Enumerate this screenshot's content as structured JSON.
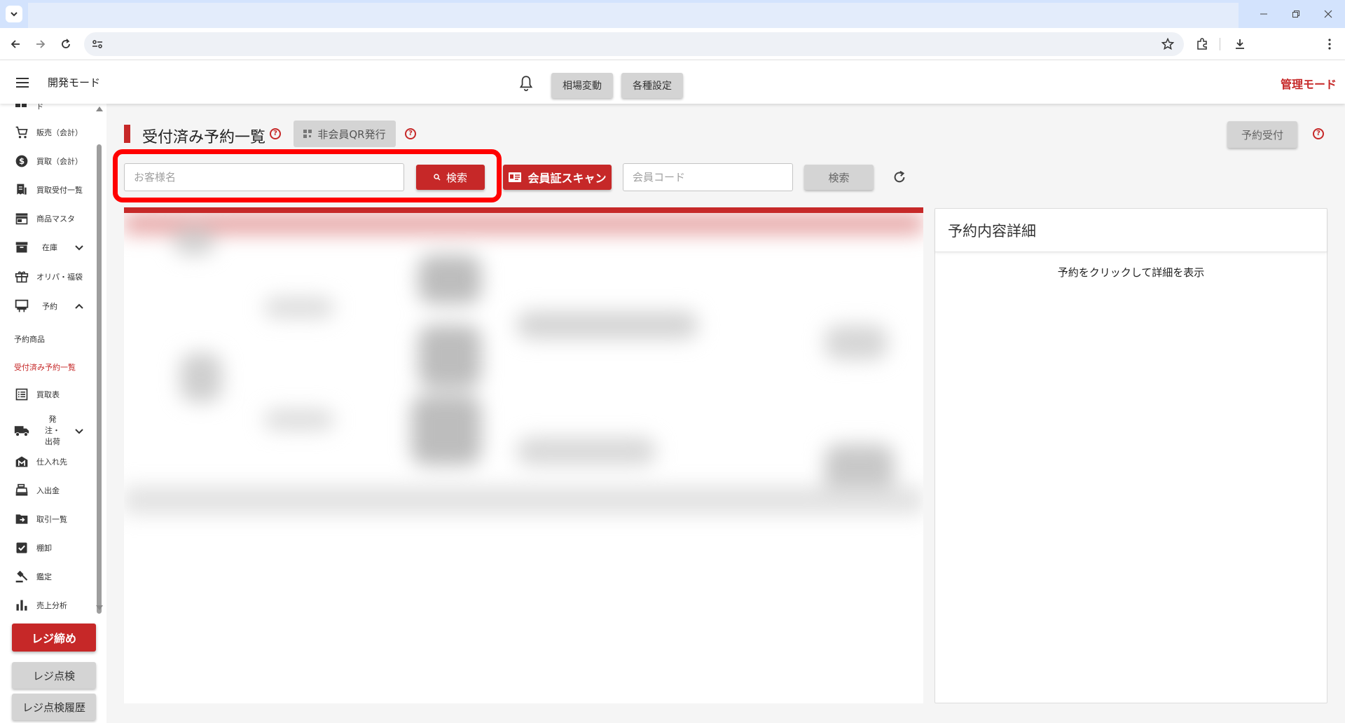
{
  "header": {
    "mode_title": "開発モード",
    "btn_market": "相場変動",
    "btn_settings": "各種設定",
    "admin_mode": "管理モード"
  },
  "sidebar": {
    "partial_item": "ド",
    "items": [
      {
        "label": "販売（会計）",
        "icon": "cart-icon"
      },
      {
        "label": "買取（会計）",
        "icon": "dollar-icon"
      },
      {
        "label": "買取受付一覧",
        "icon": "receipt-icon"
      },
      {
        "label": "商品マスタ",
        "icon": "store-icon"
      },
      {
        "label": "在庫",
        "icon": "archive-icon"
      },
      {
        "label": "オリパ・福袋",
        "icon": "gift-icon"
      },
      {
        "label": "予約",
        "icon": "kiosk-icon"
      },
      {
        "label": "買取表",
        "icon": "list-icon"
      },
      {
        "label": "発注・出荷",
        "icon": "truck-icon"
      },
      {
        "label": "仕入れ先",
        "icon": "factory-icon"
      },
      {
        "label": "入出金",
        "icon": "register-icon"
      },
      {
        "label": "取引一覧",
        "icon": "transfer-icon"
      },
      {
        "label": "棚卸",
        "icon": "checkbox-icon"
      },
      {
        "label": "鑑定",
        "icon": "gavel-icon"
      },
      {
        "label": "売上分析",
        "icon": "bar-chart-icon"
      }
    ],
    "sub_reserve_products": "予約商品",
    "sub_reserve_list": "受付済み予約一覧",
    "btn_close_register": "レジ締め",
    "btn_check_register": "レジ点検",
    "btn_check_history": "レジ点検履歴"
  },
  "main": {
    "title": "受付済み予約一覧",
    "btn_qr": "非会員QR発行",
    "btn_reserve": "予約受付",
    "customer_placeholder": "お客様名",
    "btn_search": "検索",
    "btn_scan": "会員証スキャン",
    "member_placeholder": "会員コード",
    "btn_search2": "検索",
    "help_glyph": "?"
  },
  "detail": {
    "title": "予約内容詳細",
    "empty_message": "予約をクリックして詳細を表示"
  },
  "colors": {
    "accent": "#c62828",
    "highlight": "#ff0000",
    "browser_tabstrip": "#d3e3fd"
  }
}
